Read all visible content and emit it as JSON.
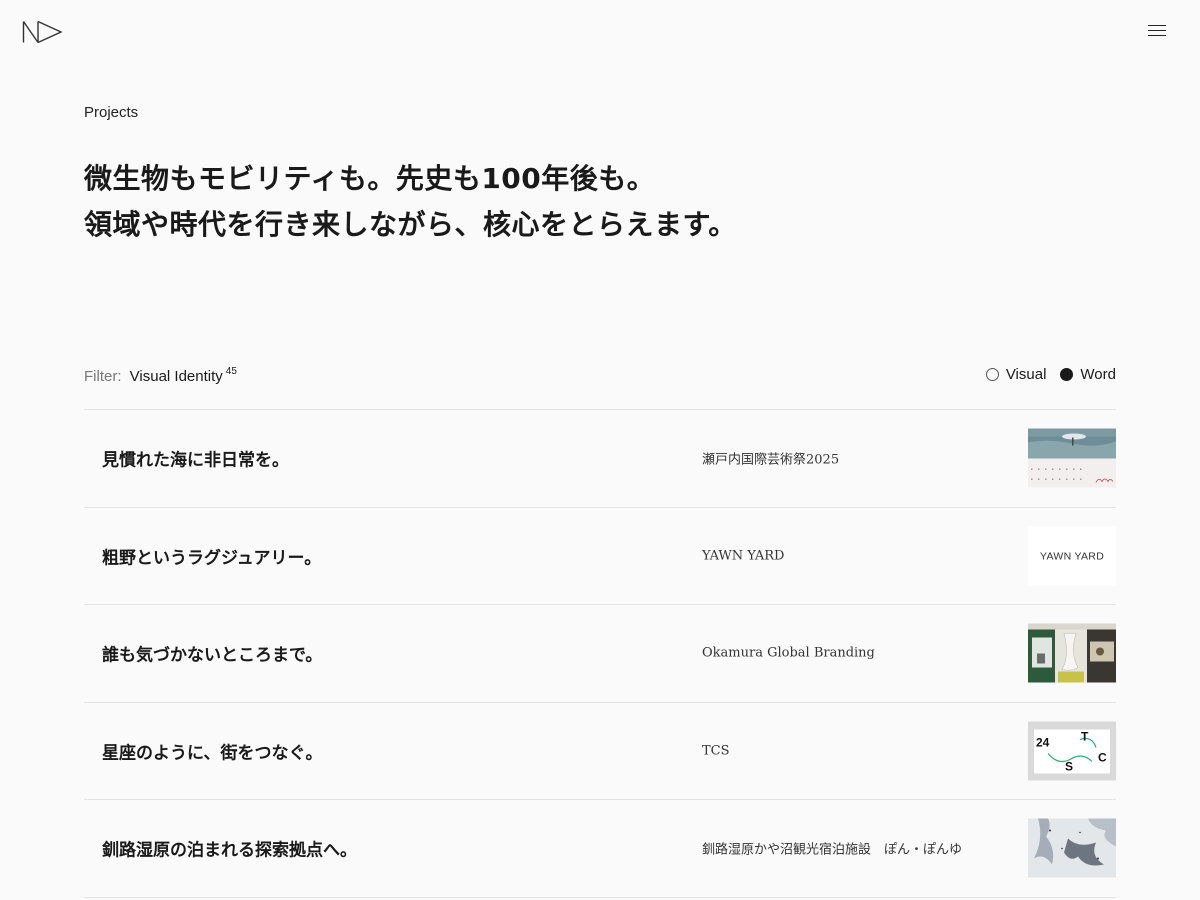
{
  "header": {
    "logo_icon": "nd-logo-icon",
    "menu_icon": "hamburger-menu-icon"
  },
  "section_label": "Projects",
  "headline": {
    "line1": "微生物もモビリティも。先史も100年後も。",
    "line2": "領域や時代を行き来しながら、核心をとらえます。"
  },
  "filter": {
    "label": "Filter:",
    "value": "Visual Identity",
    "count": "45",
    "view_options": [
      {
        "label": "Visual",
        "selected": false
      },
      {
        "label": "Word",
        "selected": true
      }
    ]
  },
  "projects": [
    {
      "title": "見慣れた海に非日常を。",
      "client": "瀬戸内国際芸術祭2025",
      "thumb": "setouchi-triennale-thumbnail"
    },
    {
      "title": "粗野というラグジュアリー。",
      "client": "YAWN YARD",
      "thumb": "yawn-yard-thumbnail",
      "thumb_text": "YAWN YARD"
    },
    {
      "title": "誰も気づかないところまで。",
      "client": "Okamura Global Branding",
      "thumb": "okamura-thumbnail"
    },
    {
      "title": "星座のように、街をつなぐ。",
      "client": "TCS",
      "thumb": "tcs-thumbnail",
      "thumb_letters": [
        "24",
        "T",
        "C",
        "S"
      ]
    },
    {
      "title": "釧路湿原の泊まれる探索拠点へ。",
      "client": "釧路湿原かや沼観光宿泊施設　ぽん・ぽんゆ",
      "thumb": "kushiro-thumbnail"
    }
  ]
}
